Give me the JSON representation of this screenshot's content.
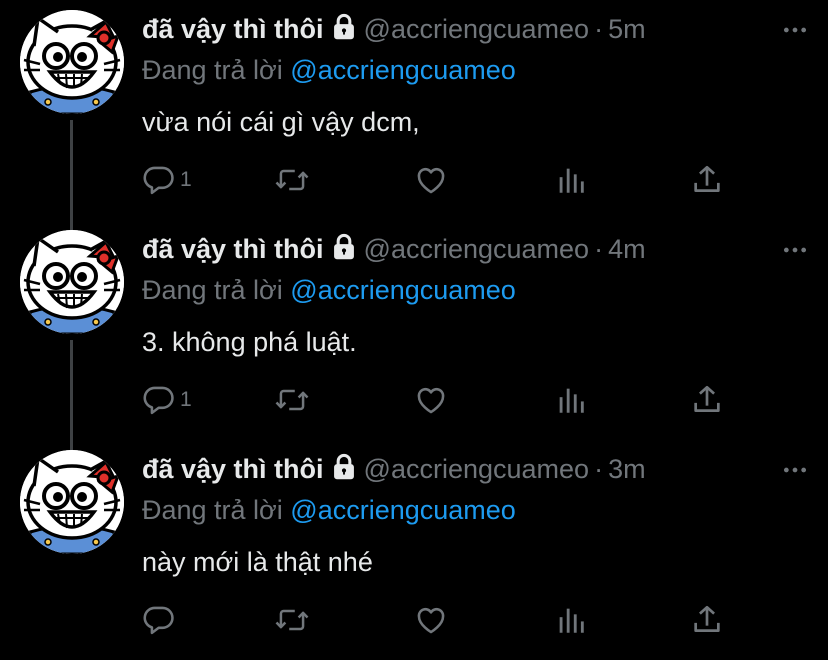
{
  "colors": {
    "background": "#000000",
    "text_primary": "#e7e9ea",
    "text_secondary": "#71767b",
    "accent": "#1d9bf0",
    "thread_line": "#3e4144"
  },
  "tweets": [
    {
      "display_name": "đã vậy thì thôi",
      "handle": "@accriengcuameo",
      "separator": "·",
      "time": "5m",
      "reply_prefix": "Đang trả lời",
      "reply_to": "@accriengcuameo",
      "text": "vừa nói cái gì vậy dcm,",
      "reply_count": "1"
    },
    {
      "display_name": "đã vậy thì thôi",
      "handle": "@accriengcuameo",
      "separator": "·",
      "time": "4m",
      "reply_prefix": "Đang trả lời",
      "reply_to": "@accriengcuameo",
      "text": "3. không phá luật.",
      "reply_count": "1"
    },
    {
      "display_name": "đã vậy thì thôi",
      "handle": "@accriengcuameo",
      "separator": "·",
      "time": "3m",
      "reply_prefix": "Đang trả lời",
      "reply_to": "@accriengcuameo",
      "text": "này mới là thật nhé",
      "reply_count": ""
    }
  ],
  "icons": {
    "lock": "lock-icon",
    "more": "more-icon",
    "reply": "reply-icon",
    "retweet": "retweet-icon",
    "like": "heart-icon",
    "views": "views-icon",
    "share": "share-icon",
    "avatar": "hello-kitty-avatar"
  }
}
